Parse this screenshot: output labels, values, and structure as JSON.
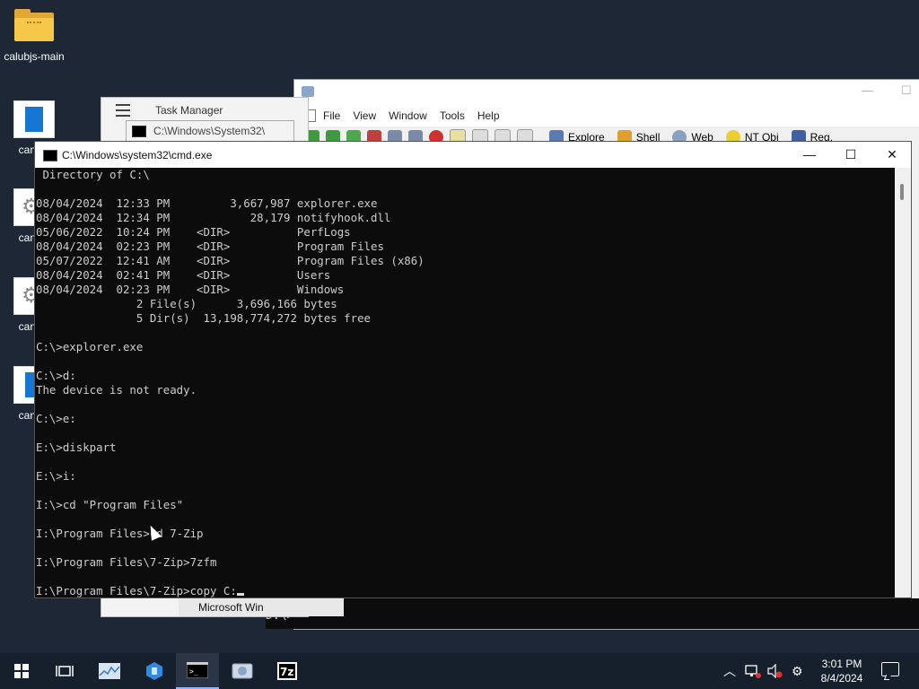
{
  "desktop": {
    "icons": [
      {
        "label": "calubjs-main",
        "icon": "zip-folder-icon"
      },
      {
        "label": "cancel",
        "icon": "document-icon"
      },
      {
        "label": "cancel",
        "icon": "settings-file-icon"
      },
      {
        "label": "cancel",
        "icon": "settings-file-icon"
      },
      {
        "label": "cancel",
        "icon": "document-icon"
      }
    ]
  },
  "zip_window": {
    "menu": [
      "File",
      "View",
      "Window",
      "Tools",
      "Help"
    ],
    "toolbar": [
      "Explore",
      "Shell",
      "Web",
      "NT Obj",
      "Reg."
    ],
    "status_prompt": "D:\\>"
  },
  "task_manager": {
    "title": "Task Manager",
    "bottom_item": "Microsoft Win"
  },
  "cmd_behind": {
    "title": "C:\\Windows\\System32\\"
  },
  "cmd": {
    "title": "C:\\Windows\\system32\\cmd.exe",
    "buttons": {
      "minimize": "—",
      "maximize": "☐",
      "close": "✕"
    },
    "lines": [
      " Directory of C:\\",
      "",
      "08/04/2024  12:33 PM         3,667,987 explorer.exe",
      "08/04/2024  12:34 PM            28,179 notifyhook.dll",
      "05/06/2022  10:24 PM    <DIR>          PerfLogs",
      "08/04/2024  02:23 PM    <DIR>          Program Files",
      "05/07/2022  12:41 AM    <DIR>          Program Files (x86)",
      "08/04/2024  02:41 PM    <DIR>          Users",
      "08/04/2024  02:23 PM    <DIR>          Windows",
      "               2 File(s)      3,696,166 bytes",
      "               5 Dir(s)  13,198,774,272 bytes free",
      "",
      "C:\\>explorer.exe",
      "",
      "C:\\>d:",
      "The device is not ready.",
      "",
      "C:\\>e:",
      "",
      "E:\\>diskpart",
      "",
      "E:\\>i:",
      "",
      "I:\\>cd \"Program Files\"",
      "",
      "I:\\Program Files>cd 7-Zip",
      "",
      "I:\\Program Files\\7-Zip>7zfm",
      ""
    ],
    "current_input": "I:\\Program Files\\7-Zip>copy C:"
  },
  "taskbar": {
    "apps": [
      "start-icon",
      "task-view-icon",
      "resource-monitor-icon",
      "app-icon",
      "cmd-icon",
      "7zip-fm-icon",
      "7zip-icon"
    ],
    "active_app": "cmd-icon",
    "time": "3:01 PM",
    "date": "8/4/2024"
  }
}
